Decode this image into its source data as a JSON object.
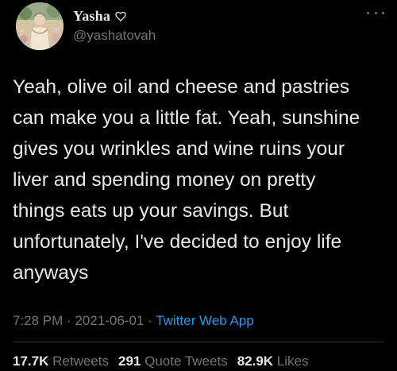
{
  "author": {
    "display_name": "Yasha",
    "handle": "@yashatovah",
    "avatar_icon": "avatar-painting",
    "name_icon": "heart-outline-icon"
  },
  "tweet": {
    "text": "Yeah, olive oil and cheese and pastries\ncan make you a little fat. Yeah, sunshine\ngives you wrinkles and wine ruins your\nliver and spending money on pretty\nthings eats up your savings. But\nunfortunately, I've decided to enjoy life\nanyways"
  },
  "meta": {
    "time": "7:28 PM",
    "separator_1": " · ",
    "date": "2021-06-01",
    "separator_2": " · ",
    "source": "Twitter Web App"
  },
  "stats": {
    "retweets_count": "17.7K",
    "retweets_label": "Retweets",
    "quotes_count": "291",
    "quotes_label": "Quote Tweets",
    "likes_count": "82.9K",
    "likes_label": "Likes"
  },
  "colors": {
    "background": "#000000",
    "text_primary": "#e7e9ea",
    "text_secondary": "#71767b",
    "link": "#1d9bf0",
    "divider": "#2f3336"
  }
}
